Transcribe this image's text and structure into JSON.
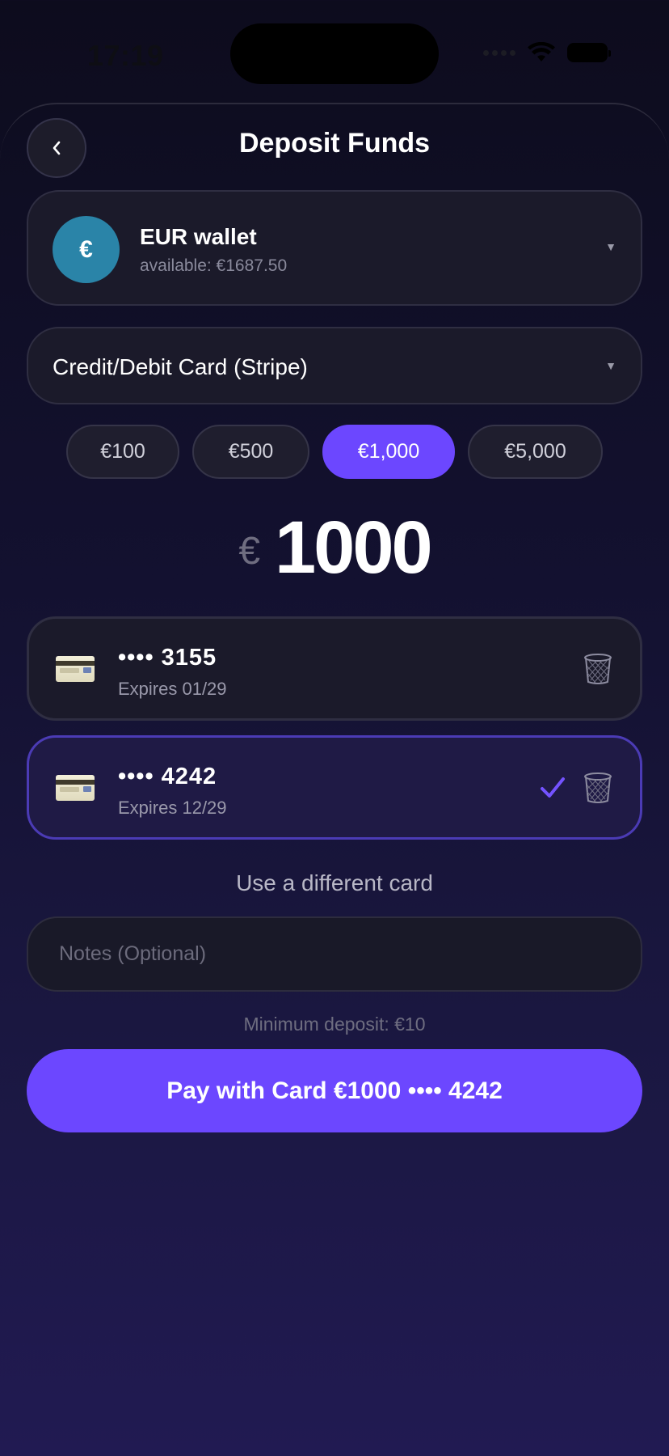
{
  "status_bar": {
    "time": "17:19"
  },
  "header": {
    "title": "Deposit Funds"
  },
  "wallet": {
    "name": "EUR wallet",
    "available": "available: €1687.50",
    "symbol": "€",
    "color": "#2a84a8"
  },
  "method": {
    "label": "Credit/Debit Card (Stripe)"
  },
  "presets": [
    {
      "label": "€100",
      "active": false
    },
    {
      "label": "€500",
      "active": false
    },
    {
      "label": "€1,000",
      "active": true
    },
    {
      "label": "€5,000",
      "active": false
    }
  ],
  "amount": {
    "currency": "€",
    "value": "1000"
  },
  "cards": [
    {
      "number": "•••• 3155",
      "expiry": "Expires 01/29",
      "selected": false
    },
    {
      "number": "•••• 4242",
      "expiry": "Expires 12/29",
      "selected": true
    }
  ],
  "different_card_label": "Use a different card",
  "notes": {
    "placeholder": "Notes (Optional)",
    "value": ""
  },
  "min_deposit": "Minimum deposit: €10",
  "pay_button": {
    "label": "Pay with Card €1000 •••• 4242"
  },
  "colors": {
    "accent": "#6c47ff",
    "selected_border": "#4b3bb5"
  }
}
